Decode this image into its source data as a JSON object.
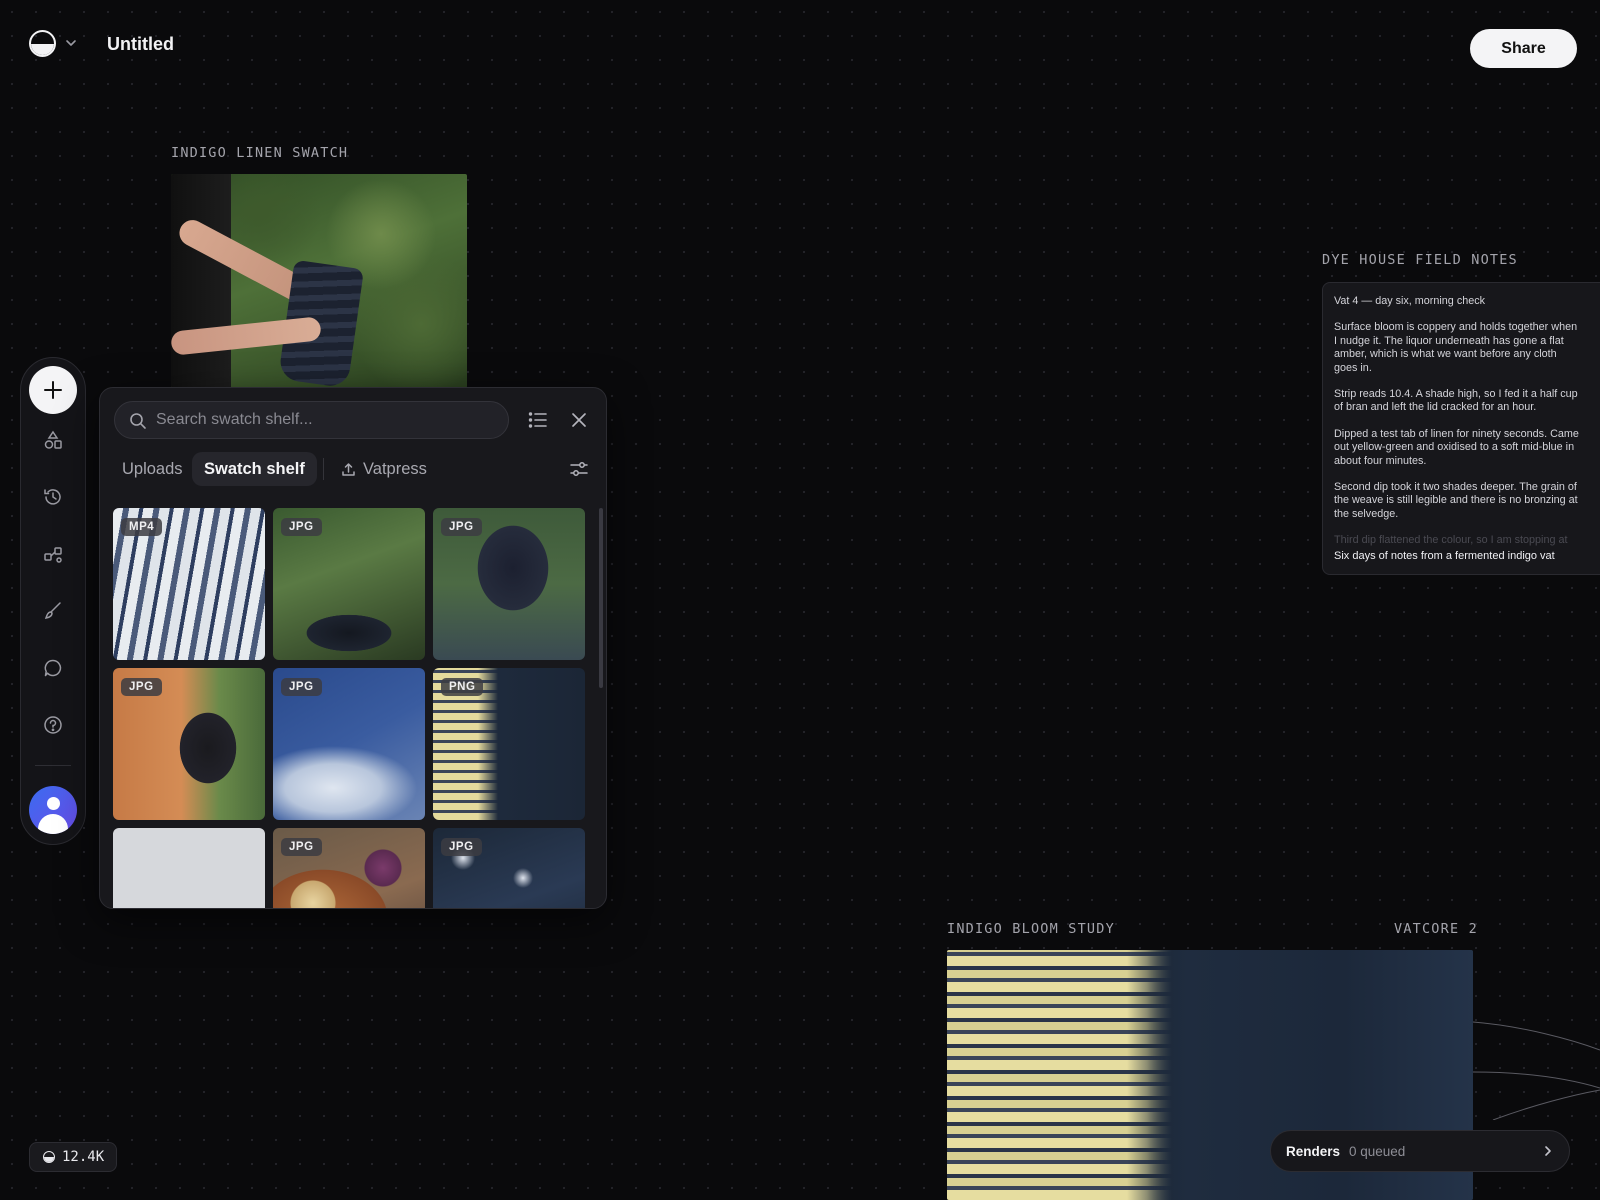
{
  "header": {
    "doc_title": "Untitled",
    "share_label": "Share",
    "logo_icon": "half-circle-logo-icon",
    "menu_icon": "chevron-down-icon"
  },
  "canvas": {
    "linen": {
      "label": "INDIGO LINEN SWATCH"
    },
    "notes": {
      "label": "DYE HOUSE FIELD NOTES",
      "paragraphs": [
        "Vat 4 — day six, morning check",
        "Surface bloom is coppery and holds together when\nI nudge it. The liquor underneath has gone a flat\namber, which is what we want before any cloth\ngoes in.",
        "Strip reads 10.4. A shade high, so I fed it a half cup\nof bran and left the lid cracked for an hour.",
        "Dipped a test tab of linen for ninety seconds. Came\nout yellow-green and oxidised to a soft mid-blue in\nabout four minutes.",
        "Second dip took it two shades deeper. The grain of\nthe weave is still legible and there is no bronzing at\nthe selvedge.",
        "Third dip flattened the colour, so I am stopping at"
      ],
      "caption": "Six days of notes from a fermented indigo vat"
    },
    "bloom": {
      "label": "INDIGO BLOOM STUDY",
      "model": "VATCORE 2"
    }
  },
  "toolbar": {
    "add_icon": "plus-icon",
    "tools": [
      "shapes-icon",
      "history-icon",
      "nodes-icon",
      "brush-icon",
      "comment-icon",
      "help-icon"
    ],
    "avatar_icon": "user-avatar-icon"
  },
  "panel": {
    "search_placeholder": "Search swatch shelf...",
    "tabs": [
      "Uploads",
      "Swatch shelf",
      "Vatpress"
    ],
    "active_tab": "Swatch shelf",
    "thumbs": [
      {
        "badge": "MP4"
      },
      {
        "badge": "JPG"
      },
      {
        "badge": "JPG"
      },
      {
        "badge": "JPG"
      },
      {
        "badge": "JPG"
      },
      {
        "badge": "PNG"
      },
      {
        "badge": ""
      },
      {
        "badge": "JPG"
      },
      {
        "badge": "JPG"
      }
    ]
  },
  "footer": {
    "credits": "12.4K",
    "renders_label": "Renders",
    "renders_count": "0 queued"
  }
}
